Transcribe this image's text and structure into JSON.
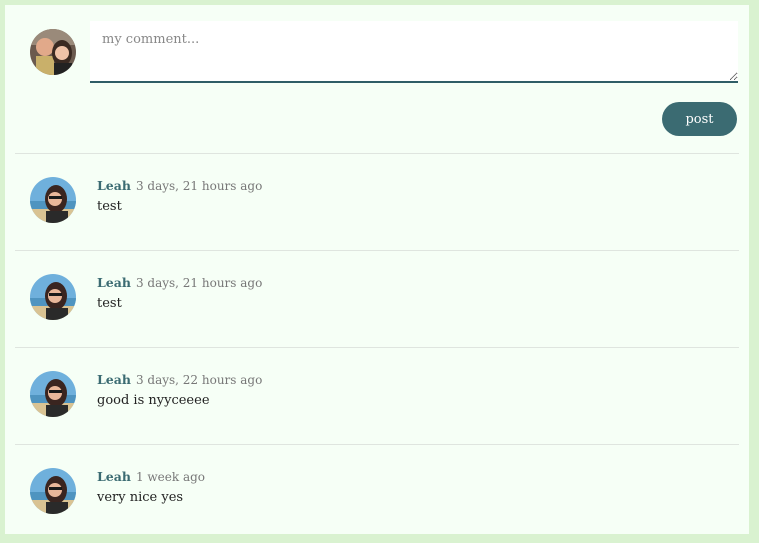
{
  "composer": {
    "placeholder": "my comment...",
    "value": "",
    "post_label": "post"
  },
  "comments": [
    {
      "author": "Leah",
      "time": "3 days, 21 hours ago",
      "text": "test"
    },
    {
      "author": "Leah",
      "time": "3 days, 21 hours ago",
      "text": "test"
    },
    {
      "author": "Leah",
      "time": "3 days, 22 hours ago",
      "text": "good is nyyceeee"
    },
    {
      "author": "Leah",
      "time": "1 week ago",
      "text": "very nice yes"
    }
  ]
}
